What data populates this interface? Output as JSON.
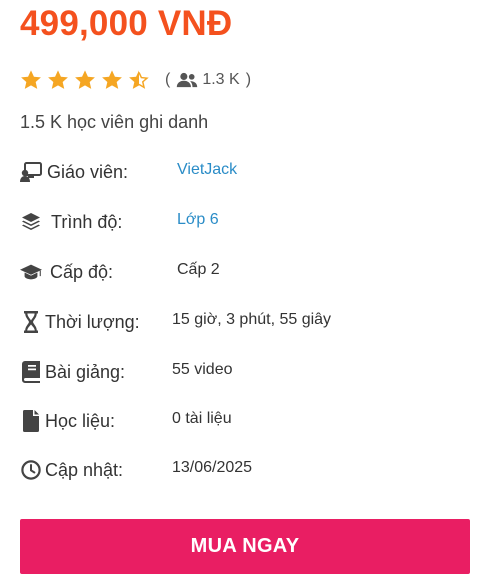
{
  "price": "499,000 VNĐ",
  "rating": {
    "value": 4.5,
    "max": 5,
    "star_color": "#f5a623",
    "count_open": "(",
    "count_text": "1.3 K",
    "count_close": ")"
  },
  "enrolled_text": "1.5 K học viên ghi danh",
  "details": [
    {
      "icon": "teacher-icon",
      "label": "Giáo viên:",
      "value": "VietJack",
      "is_link": true
    },
    {
      "icon": "layers-icon",
      "label": "Trình độ:",
      "value": "Lớp 6",
      "is_link": true
    },
    {
      "icon": "graduation-cap-icon",
      "label": "Cấp độ:",
      "value": "Cấp 2",
      "is_link": false
    },
    {
      "icon": "hourglass-icon",
      "label": "Thời lượng:",
      "value": "15 giờ, 3 phút, 55 giây",
      "is_link": false
    },
    {
      "icon": "book-icon",
      "label": "Bài giảng:",
      "value": "55 video",
      "is_link": false
    },
    {
      "icon": "file-icon",
      "label": "Học liệu:",
      "value": "0 tài liệu",
      "is_link": false
    },
    {
      "icon": "clock-icon",
      "label": "Cập nhật:",
      "value": "13/06/2025",
      "is_link": false
    }
  ],
  "buy_button": {
    "label": "MUA NGAY",
    "color": "#e91e63"
  },
  "colors": {
    "price": "#f4511e",
    "link": "#2a8cc7",
    "icon": "#444444"
  }
}
